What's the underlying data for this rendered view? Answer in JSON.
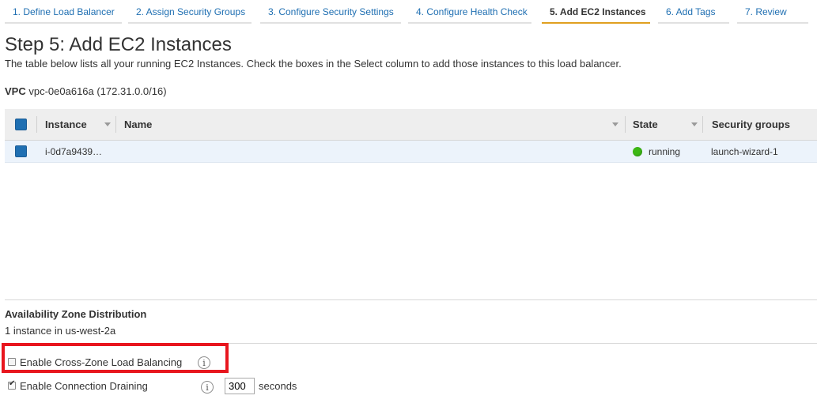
{
  "wizard": {
    "tabs": [
      {
        "label": "1. Define Load Balancer"
      },
      {
        "label": "2. Assign Security Groups"
      },
      {
        "label": "3. Configure Security Settings"
      },
      {
        "label": "4. Configure Health Check"
      },
      {
        "label": "5. Add EC2 Instances"
      },
      {
        "label": "6. Add Tags"
      },
      {
        "label": "7. Review"
      }
    ],
    "active_index": 4
  },
  "page": {
    "title": "Step 5: Add EC2 Instances",
    "description": "The table below lists all your running EC2 Instances. Check the boxes in the Select column to add those instances to this load balancer."
  },
  "vpc": {
    "label": "VPC",
    "value": "vpc-0e0a616a (172.31.0.0/16)"
  },
  "table": {
    "columns": [
      "Instance",
      "Name",
      "State",
      "Security groups"
    ],
    "rows": [
      {
        "instance": "i-0d7a9439…",
        "name": "",
        "state": "running",
        "security_groups": "launch-wizard-1",
        "selected": true
      }
    ]
  },
  "availability_zone": {
    "title": "Availability Zone Distribution",
    "text": "1 instance in us-west-2a"
  },
  "options": {
    "cross_zone": {
      "label": "Enable Cross-Zone Load Balancing",
      "checked": false
    },
    "draining": {
      "label": "Enable Connection Draining",
      "checked": true,
      "value": "300",
      "unit": "seconds"
    }
  },
  "colors": {
    "accent": "#1f6fb2",
    "active_tab_underline": "#e0a020",
    "running": "#3cb815",
    "highlight": "#e8161e"
  },
  "icons": {
    "info": "info-icon",
    "state": "status-dot-icon"
  },
  "info_glyph": "i"
}
